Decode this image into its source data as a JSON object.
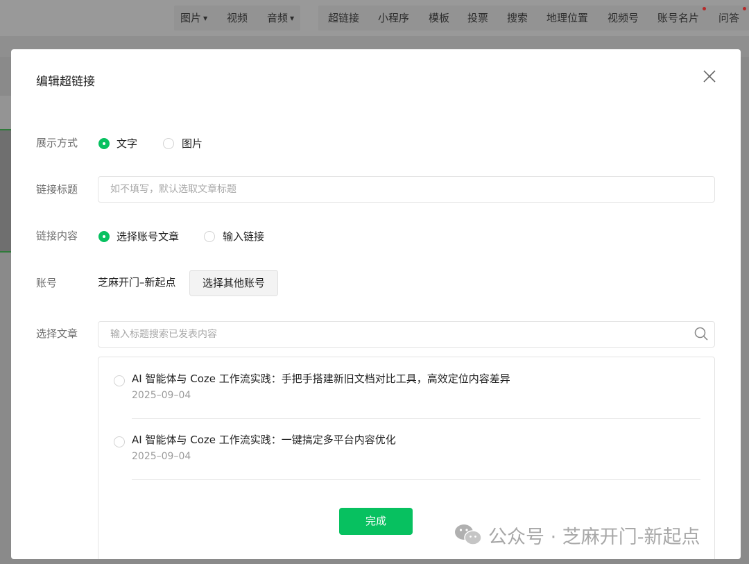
{
  "toolbar": {
    "items": [
      {
        "label": "图片",
        "dropdown": true
      },
      {
        "label": "视频",
        "dropdown": false
      },
      {
        "label": "音频",
        "dropdown": true
      },
      {
        "label": "超链接"
      },
      {
        "label": "小程序"
      },
      {
        "label": "模板"
      },
      {
        "label": "投票"
      },
      {
        "label": "搜索"
      },
      {
        "label": "地理位置"
      },
      {
        "label": "视频号"
      },
      {
        "label": "账号名片",
        "badge": true
      },
      {
        "label": "问答",
        "badge": true
      }
    ]
  },
  "dialog": {
    "title": "编辑超链接",
    "display_mode": {
      "label": "展示方式",
      "options": [
        "文字",
        "图片"
      ],
      "selected": "文字"
    },
    "link_title": {
      "label": "链接标题",
      "placeholder": "如不填写，默认选取文章标题",
      "value": ""
    },
    "link_content": {
      "label": "链接内容",
      "options": [
        "选择账号文章",
        "输入链接"
      ],
      "selected": "选择账号文章"
    },
    "account": {
      "label": "账号",
      "name": "芝麻开门–新起点",
      "switch_button": "选择其他账号"
    },
    "article_select": {
      "label": "选择文章",
      "search_placeholder": "输入标题搜索已发表内容",
      "articles": [
        {
          "title": "AI 智能体与 Coze 工作流实践：手把手搭建新旧文档对比工具，高效定位内容差异",
          "date": "2025–09–04"
        },
        {
          "title": "AI 智能体与 Coze 工作流实践：一键搞定多平台内容优化",
          "date": "2025–09–04"
        }
      ]
    },
    "done_button": "完成"
  },
  "watermark": {
    "text": "公众号 · 芝麻开门-新起点"
  },
  "colors": {
    "accent": "#07c160",
    "overlay": "#8a8a8a",
    "badge": "#b52a2a"
  }
}
